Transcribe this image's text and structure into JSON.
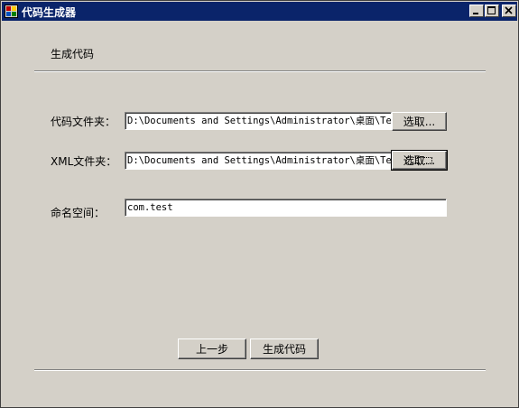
{
  "window": {
    "title": "代码生成器"
  },
  "section": {
    "title": "生成代码"
  },
  "code_folder": {
    "label": "代码文件夹：",
    "value": "D:\\Documents and Settings\\Administrator\\桌面\\Tem",
    "browse_label": "选取..."
  },
  "xml_folder": {
    "label": "XML文件夹：",
    "value": "D:\\Documents and Settings\\Administrator\\桌面\\Tem\\",
    "browse_label": "选取..."
  },
  "namespace": {
    "label": "命名空间：",
    "value": "com.test"
  },
  "footer": {
    "prev_label": "上一步",
    "generate_label": "生成代码"
  }
}
